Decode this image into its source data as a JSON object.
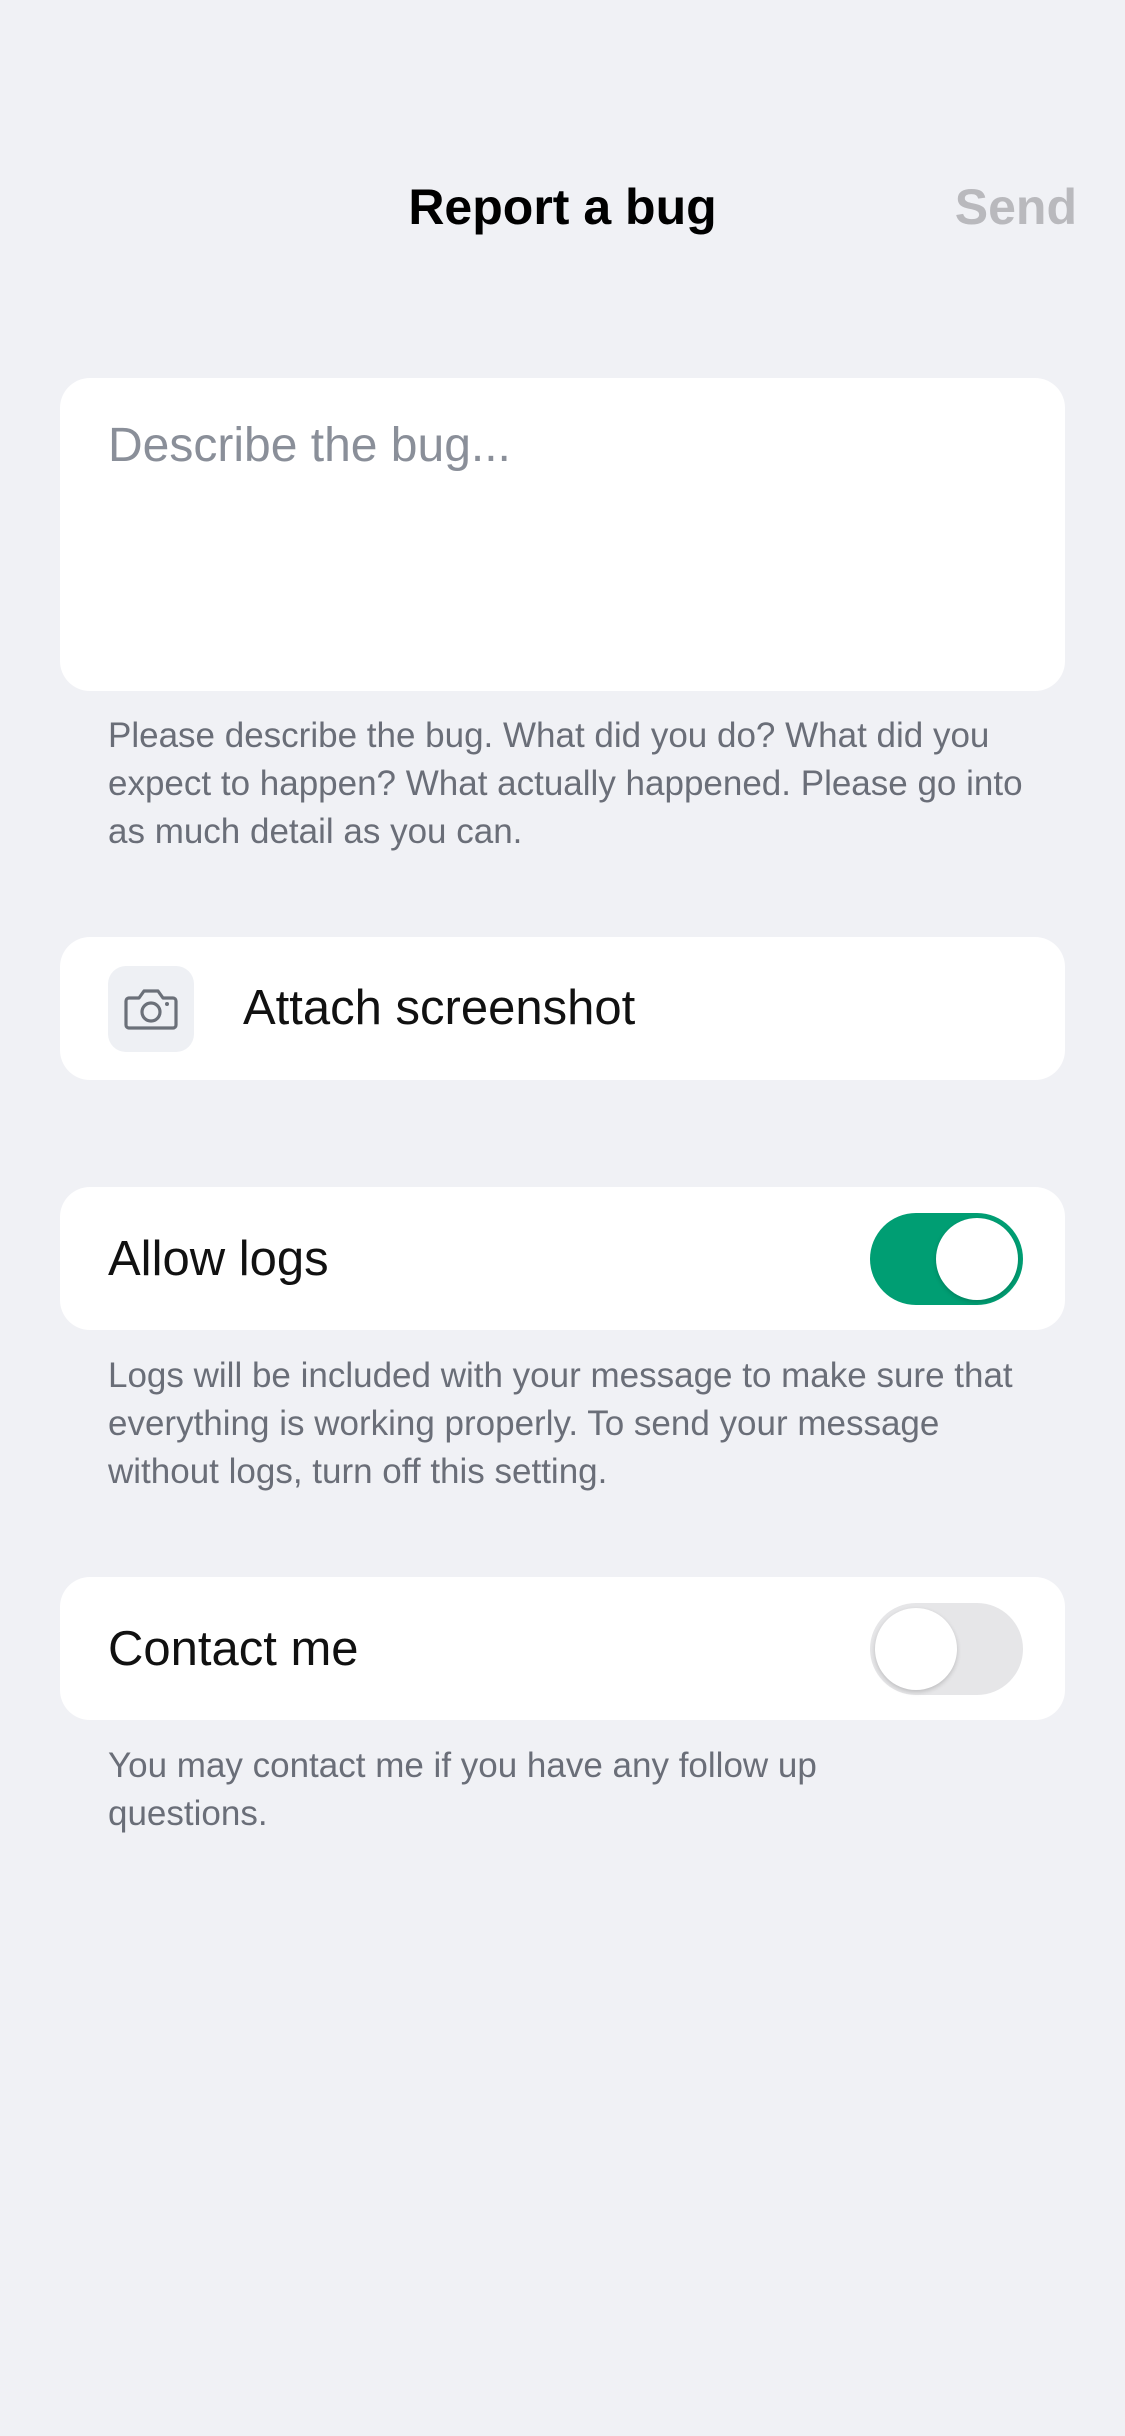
{
  "header": {
    "title": "Report a bug",
    "send_label": "Send"
  },
  "description": {
    "placeholder": "Describe the bug...",
    "value": "",
    "hint": "Please describe the bug. What did you do? What did you expect to happen? What actually happened. Please go into as much detail as you can."
  },
  "attach": {
    "icon": "camera-icon",
    "label": "Attach screenshot"
  },
  "allow_logs": {
    "label": "Allow logs",
    "enabled": true,
    "hint": "Logs will be included with your message to make sure that everything is working properly. To send your message without logs, turn off this setting."
  },
  "contact_me": {
    "label": "Contact me",
    "enabled": false,
    "hint": "You may contact me if you have any follow up questions."
  },
  "colors": {
    "background": "#f0f1f5",
    "toggle_on": "#009e73",
    "toggle_off": "#e6e6e8",
    "send_disabled": "#b9b9bd"
  }
}
